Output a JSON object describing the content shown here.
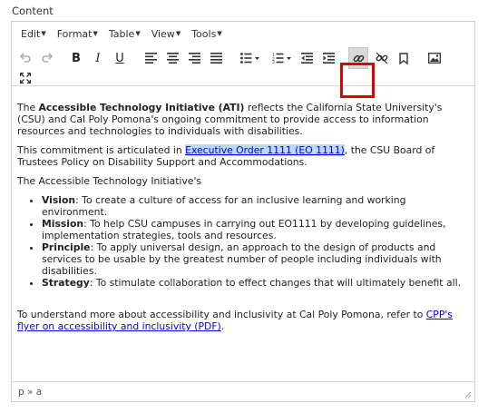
{
  "field_label": "Content",
  "menubar": {
    "items": [
      {
        "label": "Edit"
      },
      {
        "label": "Format"
      },
      {
        "label": "Table"
      },
      {
        "label": "View"
      },
      {
        "label": "Tools"
      }
    ]
  },
  "toolbar": {
    "buttons": [
      "undo-icon",
      "redo-icon",
      "bold-icon",
      "italic-icon",
      "underline-icon",
      "align-left-icon",
      "align-center-icon",
      "align-right-icon",
      "align-justify-icon",
      "bullet-list-icon",
      "numbered-list-icon",
      "outdent-icon",
      "indent-icon",
      "link-icon",
      "unlink-icon",
      "bookmark-icon",
      "image-icon",
      "fullscreen-icon"
    ],
    "active_button": "link-icon",
    "highlight_color": "#e00000",
    "bold_glyph": "B",
    "italic_glyph": "I",
    "underline_glyph": "U"
  },
  "content": {
    "p1": {
      "before": "The ",
      "bold": "Accessible Technology Initiative (ATI)",
      "after": " reflects the California State University's (CSU) and Cal Poly Pomona's ongoing commitment to provide access to information resources and technologies to individuals with disabilities."
    },
    "p2": {
      "before": "This commitment is articulated in ",
      "link": "Executive Order 1111 (EO 1111)",
      "after": ", the CSU Board of Trustees Policy on Disability Support and Accommodations."
    },
    "p3": "The Accessible Technology Initiative's",
    "list": [
      {
        "term": "Vision",
        "text": ": To create a culture of access for an inclusive learning and working environment."
      },
      {
        "term": "Mission",
        "text": ": To help CSU campuses in carrying out EO1111 by developing guidelines, implementation strategies, tools and resources."
      },
      {
        "term": "Principle",
        "text": ": To apply universal design, an approach to the design of products and services to be usable by the greatest number of people including individuals with disabilities."
      },
      {
        "term": "Strategy",
        "text": ": To stimulate collaboration to effect changes that will ultimately benefit all."
      }
    ],
    "p4": {
      "before": "To understand more about accessibility and inclusivity at Cal Poly Pomona, refer to ",
      "link": "CPP's flyer on accessibility and inclusivity (PDF)",
      "after": "."
    }
  },
  "statusbar": {
    "path": "p » a"
  },
  "colors": {
    "link": "#0000ee",
    "selection": "#bcd7f7",
    "highlight": "#e00000"
  }
}
